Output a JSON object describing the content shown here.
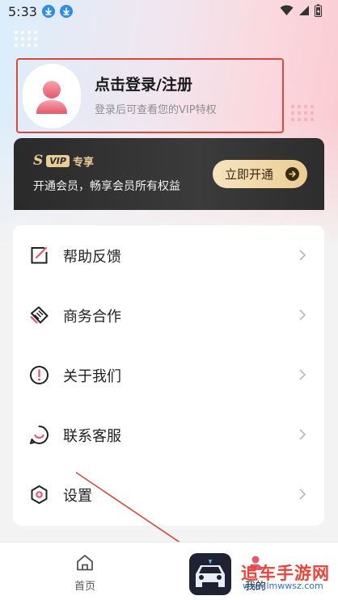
{
  "status_bar": {
    "time": "5:33",
    "icons": [
      "download-icon",
      "download-icon",
      "wifi-icon",
      "signal-icon",
      "battery-icon"
    ]
  },
  "profile": {
    "title": "点击登录/注册",
    "subtitle": "登录后可查看您的VIP特权",
    "avatar_icon": "user-avatar-icon"
  },
  "vip": {
    "badge_s": "S",
    "badge_vip": "VIP",
    "badge_label": "专享",
    "description": "开通会员，畅享会员所有权益",
    "button_label": "立即开通",
    "accent": "#e8cc98"
  },
  "menu": {
    "items": [
      {
        "label": "帮助反馈",
        "icon": "feedback-icon"
      },
      {
        "label": "商务合作",
        "icon": "handshake-icon"
      },
      {
        "label": "关于我们",
        "icon": "info-icon"
      },
      {
        "label": "联系客服",
        "icon": "customer-service-icon"
      },
      {
        "label": "设置",
        "icon": "settings-icon"
      }
    ]
  },
  "tabbar": {
    "tabs": [
      {
        "label": "首页",
        "icon": "home-icon",
        "active": false
      },
      {
        "label": "我的",
        "icon": "profile-icon",
        "active": true
      }
    ]
  },
  "watermark": {
    "title": "追车手游网",
    "url": "www.lmwwsz.com"
  },
  "colors": {
    "annotation": "#d64a3c",
    "brand_red": "#e8443a",
    "vip_gold": "#e8cc98"
  }
}
